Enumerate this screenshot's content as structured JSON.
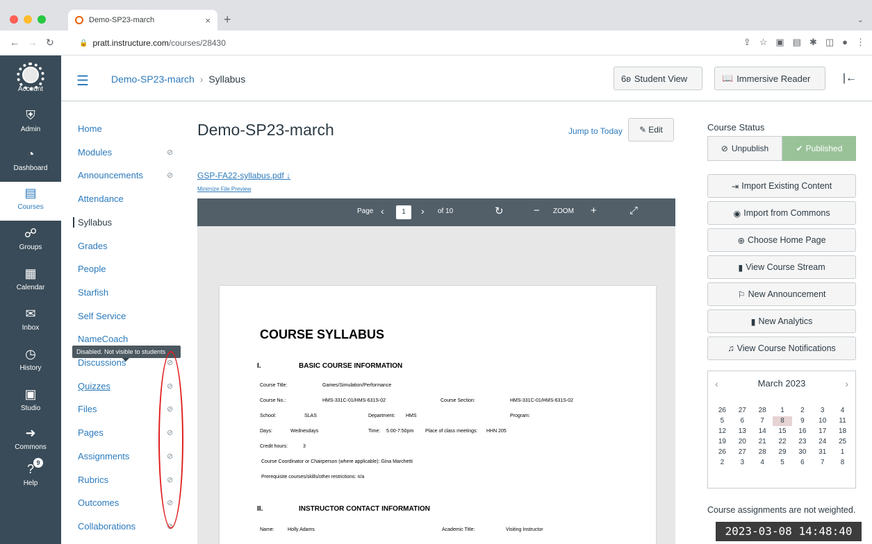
{
  "browser": {
    "tab_title": "Demo-SP23-march",
    "tab_close": "×",
    "new_tab": "+",
    "url_host": "pratt.instructure.com",
    "url_path": "/courses/28430"
  },
  "global_nav": [
    {
      "label": "Account",
      "icon": "avatar-icon"
    },
    {
      "label": "Admin",
      "icon": "shield-icon"
    },
    {
      "label": "Dashboard",
      "icon": "dashboard-icon"
    },
    {
      "label": "Courses",
      "icon": "book-icon",
      "active": true
    },
    {
      "label": "Groups",
      "icon": "groups-icon"
    },
    {
      "label": "Calendar",
      "icon": "calendar-icon"
    },
    {
      "label": "Inbox",
      "icon": "inbox-icon"
    },
    {
      "label": "History",
      "icon": "clock-icon"
    },
    {
      "label": "Studio",
      "icon": "studio-icon"
    },
    {
      "label": "Commons",
      "icon": "commons-icon"
    },
    {
      "label": "Help",
      "icon": "help-icon",
      "badge": "9"
    }
  ],
  "header": {
    "course_link": "Demo-SP23-march",
    "separator": "›",
    "current": "Syllabus",
    "student_view": "Student View",
    "immersive_reader": "Immersive Reader"
  },
  "course_nav": [
    {
      "label": "Home",
      "hidden": false
    },
    {
      "label": "Modules",
      "hidden": true
    },
    {
      "label": "Announcements",
      "hidden": true
    },
    {
      "label": "Attendance",
      "hidden": false
    },
    {
      "label": "Syllabus",
      "hidden": false,
      "active": true
    },
    {
      "label": "Grades",
      "hidden": false
    },
    {
      "label": "People",
      "hidden": false
    },
    {
      "label": "Starfish",
      "hidden": false
    },
    {
      "label": "Self Service",
      "hidden": false
    },
    {
      "label": "NameCoach",
      "hidden": false
    },
    {
      "label": "Discussions",
      "hidden": true
    },
    {
      "label": "Quizzes",
      "hidden": true
    },
    {
      "label": "Files",
      "hidden": true
    },
    {
      "label": "Pages",
      "hidden": true
    },
    {
      "label": "Assignments",
      "hidden": true
    },
    {
      "label": "Rubrics",
      "hidden": true
    },
    {
      "label": "Outcomes",
      "hidden": true
    },
    {
      "label": "Collaborations",
      "hidden": true
    }
  ],
  "tooltip": "Disabled. Not visible to students",
  "main": {
    "title": "Demo-SP23-march",
    "jump_to_today": "Jump to Today",
    "edit": "Edit",
    "file_link": "GSP-FA22-syllabus.pdf",
    "minimize": "Minimize File Preview",
    "pdf": {
      "page_label": "Page",
      "page_value": "1",
      "of_pages": "of 10",
      "zoom_label": "ZOOM"
    },
    "doc": {
      "title": "COURSE SYLLABUS",
      "section1_num": "I.",
      "section1": "BASIC COURSE INFORMATION",
      "course_title_label": "Course Title:",
      "course_title": "Games/Simulation/Performance",
      "course_no_label": "Course No.:",
      "course_no": "HMS-331C-01/HMS-631S-02",
      "course_section_label": "Course Section:",
      "course_section": "HMS-331C-01/HMS-631S-02",
      "school_label": "School:",
      "school": "SLAS",
      "department_label": "Department:",
      "department": "HMS",
      "program_label": "Program:",
      "days_label": "Days:",
      "days": "Wednesdays",
      "time_label": "Time:",
      "time": "5:00-7:50pm",
      "place_label": "Place of class meetings:",
      "place": "HHN 205",
      "credit_label": "Credit hours:",
      "credit": "3",
      "coordinator": "Course Coordinator or Chairperson (where applicable): Gina Marchetti",
      "prereq": "Prerequisite courses/skills/other restrictions: n/a",
      "section2_num": "II.",
      "section2": "INSTRUCTOR CONTACT INFORMATION",
      "name_label": "Name:",
      "name": "Holly Adams",
      "academic_title_label": "Academic Title:",
      "academic_title": "Visiting Instructor"
    }
  },
  "sidebar": {
    "course_status": "Course Status",
    "unpublish": "Unpublish",
    "published": "Published",
    "buttons": [
      "Import Existing Content",
      "Import from Commons",
      "Choose Home Page",
      "View Course Stream",
      "New Announcement",
      "New Analytics",
      "View Course Notifications"
    ],
    "calendar": {
      "month": "March 2023",
      "prev": "‹",
      "next": "›",
      "days": [
        "26",
        "27",
        "28",
        "1",
        "2",
        "3",
        "4",
        "5",
        "6",
        "7",
        "8",
        "9",
        "10",
        "11",
        "12",
        "13",
        "14",
        "15",
        "16",
        "17",
        "18",
        "19",
        "20",
        "21",
        "22",
        "23",
        "24",
        "25",
        "26",
        "27",
        "28",
        "29",
        "30",
        "31",
        "1",
        "2",
        "3",
        "4",
        "5",
        "6",
        "7",
        "8"
      ],
      "today_index": 10
    },
    "assignments_note": "Course assignments are not weighted."
  },
  "timestamp": "2023-03-08 14:48:40",
  "colors": {
    "nav_bg": "#394b58",
    "link": "#2b7abc",
    "published": "#8fbc8f",
    "highlight_oval": "#e01f1f"
  }
}
